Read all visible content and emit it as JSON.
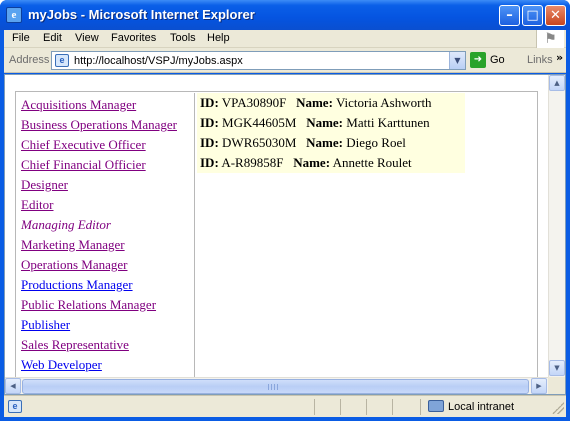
{
  "window": {
    "title": "myJobs - Microsoft Internet Explorer",
    "app_icon_glyph": "e",
    "buttons": {
      "minimize": "–",
      "maximize": "□",
      "close": "✕"
    }
  },
  "menu": [
    "File",
    "Edit",
    "View",
    "Favorites",
    "Tools",
    "Help"
  ],
  "address_bar": {
    "label": "Address",
    "url": "http://localhost/VSPJ/myJobs.aspx",
    "go_label": "Go",
    "links_label": "Links",
    "links_chevron": "»"
  },
  "jobs": [
    {
      "label": "Acquisitions Manager",
      "state": "visited"
    },
    {
      "label": "Business Operations Manager",
      "state": "visited"
    },
    {
      "label": "Chief Executive Officer",
      "state": "visited"
    },
    {
      "label": "Chief Financial Officier",
      "state": "visited"
    },
    {
      "label": "Designer",
      "state": "visited"
    },
    {
      "label": "Editor",
      "state": "visited"
    },
    {
      "label": "Managing Editor",
      "state": "current"
    },
    {
      "label": "Marketing Manager",
      "state": "visited"
    },
    {
      "label": "Operations Manager",
      "state": "visited"
    },
    {
      "label": "Productions Manager",
      "state": "unvisited"
    },
    {
      "label": "Public Relations Manager",
      "state": "visited"
    },
    {
      "label": "Publisher",
      "state": "unvisited"
    },
    {
      "label": "Sales Representative",
      "state": "visited"
    },
    {
      "label": "Web Developer",
      "state": "unvisited"
    }
  ],
  "results": {
    "id_label": "ID:",
    "name_label": "Name:",
    "rows": [
      {
        "id": "VPA30890F",
        "name": "Victoria Ashworth"
      },
      {
        "id": "MGK44605M",
        "name": "Matti Karttunen"
      },
      {
        "id": "DWR65030M",
        "name": "Diego Roel"
      },
      {
        "id": "A-R89858F",
        "name": "Annette Roulet"
      }
    ]
  },
  "status_bar": {
    "zone": "Local intranet"
  },
  "colors": {
    "link_visited": "#800080",
    "link_unvisited": "#0000ee",
    "results_background": "#ffffe0",
    "titlebar_blue": "#0554e0"
  }
}
